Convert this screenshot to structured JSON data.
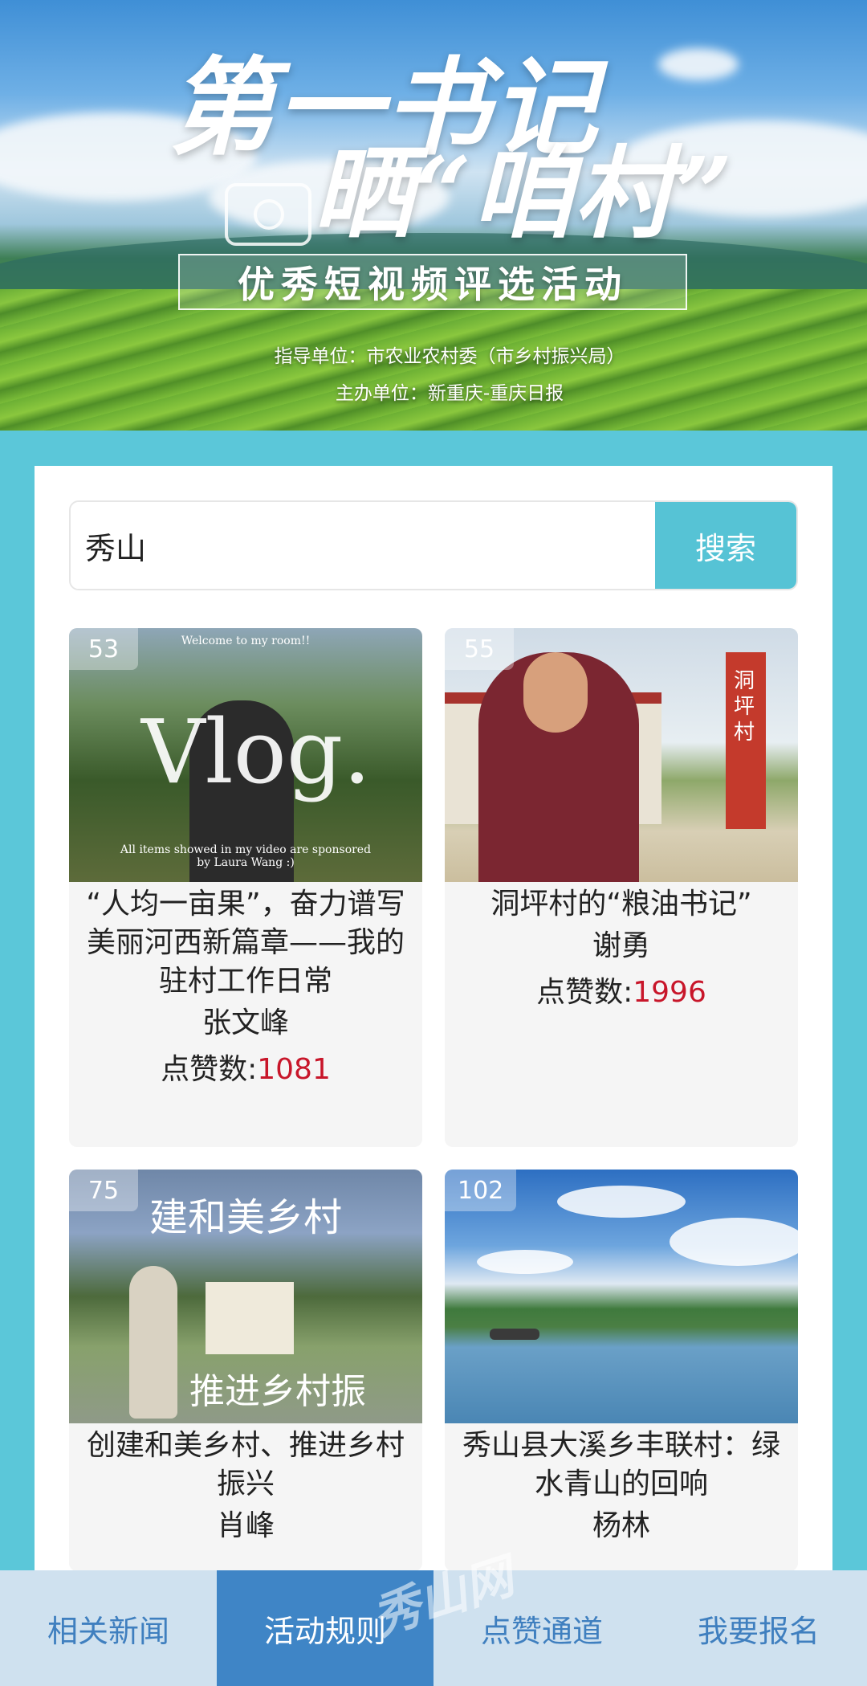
{
  "banner": {
    "title_line1": "第一书记",
    "title_line2": "晒“咱村”",
    "subtitle": "优秀短视频评选活动",
    "guide_unit": "指导单位：市农业农村委（市乡村振兴局）",
    "host_unit": "主办单位：新重庆-重庆日报"
  },
  "search": {
    "value": "秀山",
    "button_label": "搜索"
  },
  "cards": [
    {
      "badge": "53",
      "thumb_text": "Vlog.",
      "thumb_small_top": "Welcome to my room!!",
      "thumb_small_bottom": "All items showed in my video are sponsored by Laura Wang :)",
      "title": "“人均一亩果”，奋力谱写美丽河西新篇章——我的驻村工作日常",
      "author": "张文峰",
      "likes_label": "点赞数:",
      "likes": "1081"
    },
    {
      "badge": "55",
      "thumb_text": "洞坪村",
      "title": "洞坪村的“粮油书记”",
      "author": "谢勇",
      "likes_label": "点赞数:",
      "likes": "1996"
    },
    {
      "badge": "75",
      "thumb_text": "建和美乡村",
      "thumb_text2": "推进乡村振",
      "title": "创建和美乡村、推进乡村振兴",
      "author": "肖峰"
    },
    {
      "badge": "102",
      "title": "秀山县大溪乡丰联村：绿水青山的回响",
      "author": "杨林"
    }
  ],
  "tabs": [
    {
      "label": "相关新闻"
    },
    {
      "label": "活动规则"
    },
    {
      "label": "点赞通道"
    },
    {
      "label": "我要报名"
    }
  ],
  "watermark": "秀山网"
}
